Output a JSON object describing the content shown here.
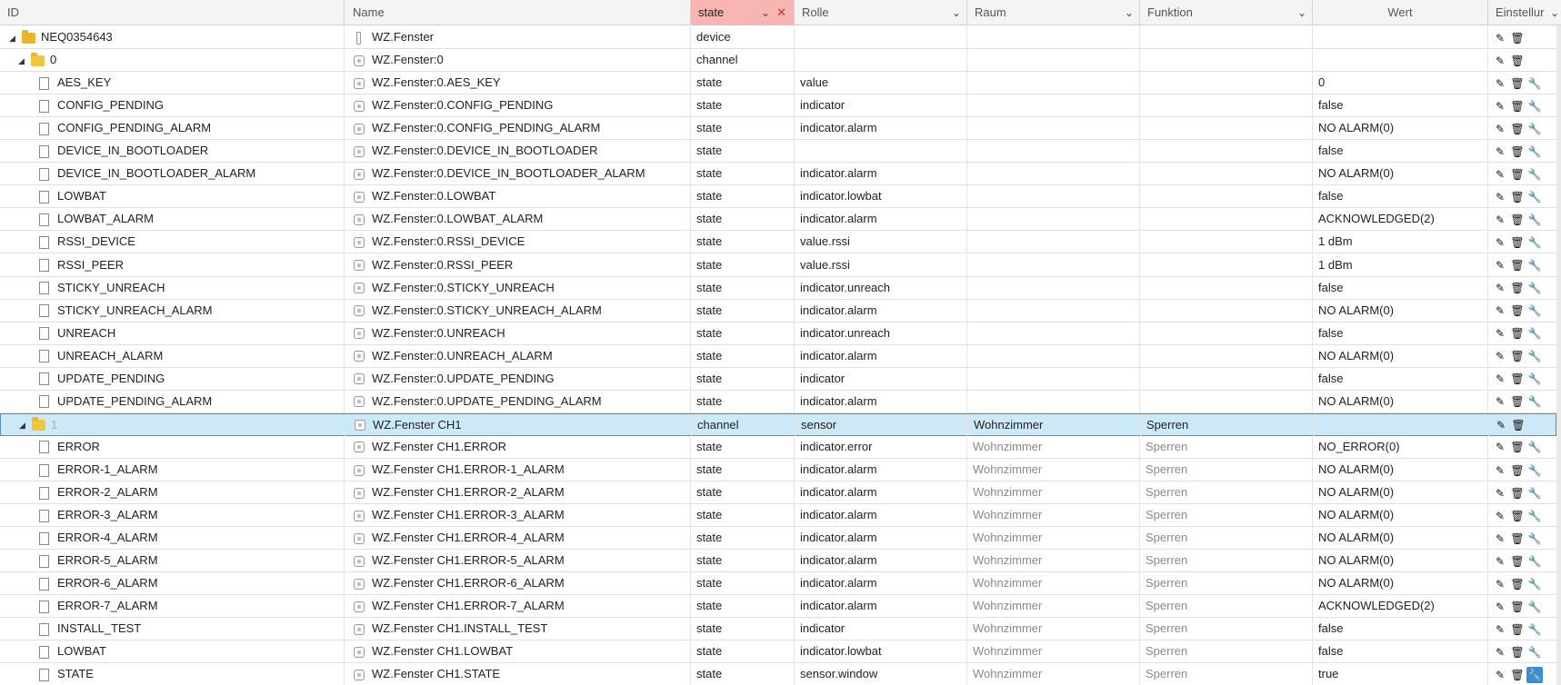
{
  "columns": {
    "id": "ID",
    "name": "Name",
    "type_filter": "state",
    "role": "Rolle",
    "room": "Raum",
    "function": "Funktion",
    "value": "Wert",
    "settings": "Einstellur"
  },
  "icons": {
    "edit": "✎",
    "delete": "🗑",
    "settings": "🔧",
    "expand": "◢",
    "dropdown": "⌄",
    "clear": "✕"
  },
  "rows": [
    {
      "id": "NEQ0354643",
      "name": "WZ.Fenster",
      "type": "device",
      "role": "",
      "room": "",
      "func": "",
      "value": "",
      "kind": "device",
      "level": 0
    },
    {
      "id": "0",
      "name": "WZ.Fenster:0",
      "type": "channel",
      "role": "",
      "room": "",
      "func": "",
      "value": "",
      "kind": "channel",
      "level": 1
    },
    {
      "id": "AES_KEY",
      "name": "WZ.Fenster:0.AES_KEY",
      "type": "state",
      "role": "value",
      "room": "",
      "func": "",
      "value": "0",
      "kind": "state",
      "level": 2
    },
    {
      "id": "CONFIG_PENDING",
      "name": "WZ.Fenster:0.CONFIG_PENDING",
      "type": "state",
      "role": "indicator",
      "room": "",
      "func": "",
      "value": "false",
      "kind": "state",
      "level": 2
    },
    {
      "id": "CONFIG_PENDING_ALARM",
      "name": "WZ.Fenster:0.CONFIG_PENDING_ALARM",
      "type": "state",
      "role": "indicator.alarm",
      "room": "",
      "func": "",
      "value": "NO ALARM(0)",
      "kind": "state",
      "level": 2
    },
    {
      "id": "DEVICE_IN_BOOTLOADER",
      "name": "WZ.Fenster:0.DEVICE_IN_BOOTLOADER",
      "type": "state",
      "role": "",
      "room": "",
      "func": "",
      "value": "false",
      "kind": "state",
      "level": 2
    },
    {
      "id": "DEVICE_IN_BOOTLOADER_ALARM",
      "name": "WZ.Fenster:0.DEVICE_IN_BOOTLOADER_ALARM",
      "type": "state",
      "role": "indicator.alarm",
      "room": "",
      "func": "",
      "value": "NO ALARM(0)",
      "kind": "state",
      "level": 2
    },
    {
      "id": "LOWBAT",
      "name": "WZ.Fenster:0.LOWBAT",
      "type": "state",
      "role": "indicator.lowbat",
      "room": "",
      "func": "",
      "value": "false",
      "kind": "state",
      "level": 2
    },
    {
      "id": "LOWBAT_ALARM",
      "name": "WZ.Fenster:0.LOWBAT_ALARM",
      "type": "state",
      "role": "indicator.alarm",
      "room": "",
      "func": "",
      "value": "ACKNOWLEDGED(2)",
      "kind": "state",
      "level": 2
    },
    {
      "id": "RSSI_DEVICE",
      "name": "WZ.Fenster:0.RSSI_DEVICE",
      "type": "state",
      "role": "value.rssi",
      "room": "",
      "func": "",
      "value": "1 dBm",
      "kind": "state",
      "level": 2
    },
    {
      "id": "RSSI_PEER",
      "name": "WZ.Fenster:0.RSSI_PEER",
      "type": "state",
      "role": "value.rssi",
      "room": "",
      "func": "",
      "value": "1 dBm",
      "kind": "state",
      "level": 2
    },
    {
      "id": "STICKY_UNREACH",
      "name": "WZ.Fenster:0.STICKY_UNREACH",
      "type": "state",
      "role": "indicator.unreach",
      "room": "",
      "func": "",
      "value": "false",
      "kind": "state",
      "level": 2
    },
    {
      "id": "STICKY_UNREACH_ALARM",
      "name": "WZ.Fenster:0.STICKY_UNREACH_ALARM",
      "type": "state",
      "role": "indicator.alarm",
      "room": "",
      "func": "",
      "value": "NO ALARM(0)",
      "kind": "state",
      "level": 2
    },
    {
      "id": "UNREACH",
      "name": "WZ.Fenster:0.UNREACH",
      "type": "state",
      "role": "indicator.unreach",
      "room": "",
      "func": "",
      "value": "false",
      "kind": "state",
      "level": 2
    },
    {
      "id": "UNREACH_ALARM",
      "name": "WZ.Fenster:0.UNREACH_ALARM",
      "type": "state",
      "role": "indicator.alarm",
      "room": "",
      "func": "",
      "value": "NO ALARM(0)",
      "kind": "state",
      "level": 2
    },
    {
      "id": "UPDATE_PENDING",
      "name": "WZ.Fenster:0.UPDATE_PENDING",
      "type": "state",
      "role": "indicator",
      "room": "",
      "func": "",
      "value": "false",
      "kind": "state",
      "level": 2
    },
    {
      "id": "UPDATE_PENDING_ALARM",
      "name": "WZ.Fenster:0.UPDATE_PENDING_ALARM",
      "type": "state",
      "role": "indicator.alarm",
      "room": "",
      "func": "",
      "value": "NO ALARM(0)",
      "kind": "state",
      "level": 2
    },
    {
      "id": "1",
      "name": "WZ.Fenster CH1",
      "type": "channel",
      "role": "sensor",
      "room": "Wohnzimmer",
      "func": "Sperren",
      "value": "",
      "kind": "channel",
      "level": 1,
      "selected": true
    },
    {
      "id": "ERROR",
      "name": "WZ.Fenster CH1.ERROR",
      "type": "state",
      "role": "indicator.error",
      "room": "Wohnzimmer",
      "func": "Sperren",
      "value": "NO_ERROR(0)",
      "kind": "state",
      "level": 2
    },
    {
      "id": "ERROR-1_ALARM",
      "name": "WZ.Fenster CH1.ERROR-1_ALARM",
      "type": "state",
      "role": "indicator.alarm",
      "room": "Wohnzimmer",
      "func": "Sperren",
      "value": "NO ALARM(0)",
      "kind": "state",
      "level": 2
    },
    {
      "id": "ERROR-2_ALARM",
      "name": "WZ.Fenster CH1.ERROR-2_ALARM",
      "type": "state",
      "role": "indicator.alarm",
      "room": "Wohnzimmer",
      "func": "Sperren",
      "value": "NO ALARM(0)",
      "kind": "state",
      "level": 2
    },
    {
      "id": "ERROR-3_ALARM",
      "name": "WZ.Fenster CH1.ERROR-3_ALARM",
      "type": "state",
      "role": "indicator.alarm",
      "room": "Wohnzimmer",
      "func": "Sperren",
      "value": "NO ALARM(0)",
      "kind": "state",
      "level": 2
    },
    {
      "id": "ERROR-4_ALARM",
      "name": "WZ.Fenster CH1.ERROR-4_ALARM",
      "type": "state",
      "role": "indicator.alarm",
      "room": "Wohnzimmer",
      "func": "Sperren",
      "value": "NO ALARM(0)",
      "kind": "state",
      "level": 2
    },
    {
      "id": "ERROR-5_ALARM",
      "name": "WZ.Fenster CH1.ERROR-5_ALARM",
      "type": "state",
      "role": "indicator.alarm",
      "room": "Wohnzimmer",
      "func": "Sperren",
      "value": "NO ALARM(0)",
      "kind": "state",
      "level": 2
    },
    {
      "id": "ERROR-6_ALARM",
      "name": "WZ.Fenster CH1.ERROR-6_ALARM",
      "type": "state",
      "role": "indicator.alarm",
      "room": "Wohnzimmer",
      "func": "Sperren",
      "value": "NO ALARM(0)",
      "kind": "state",
      "level": 2
    },
    {
      "id": "ERROR-7_ALARM",
      "name": "WZ.Fenster CH1.ERROR-7_ALARM",
      "type": "state",
      "role": "indicator.alarm",
      "room": "Wohnzimmer",
      "func": "Sperren",
      "value": "ACKNOWLEDGED(2)",
      "kind": "state",
      "level": 2
    },
    {
      "id": "INSTALL_TEST",
      "name": "WZ.Fenster CH1.INSTALL_TEST",
      "type": "state",
      "role": "indicator",
      "room": "Wohnzimmer",
      "func": "Sperren",
      "value": "false",
      "kind": "state",
      "level": 2
    },
    {
      "id": "LOWBAT",
      "name": "WZ.Fenster CH1.LOWBAT",
      "type": "state",
      "role": "indicator.lowbat",
      "room": "Wohnzimmer",
      "func": "Sperren",
      "value": "false",
      "kind": "state",
      "level": 2
    },
    {
      "id": "STATE",
      "name": "WZ.Fenster CH1.STATE",
      "type": "state",
      "role": "sensor.window",
      "room": "Wohnzimmer",
      "func": "Sperren",
      "value": "true",
      "kind": "state",
      "level": 2,
      "settings_active": true
    }
  ]
}
